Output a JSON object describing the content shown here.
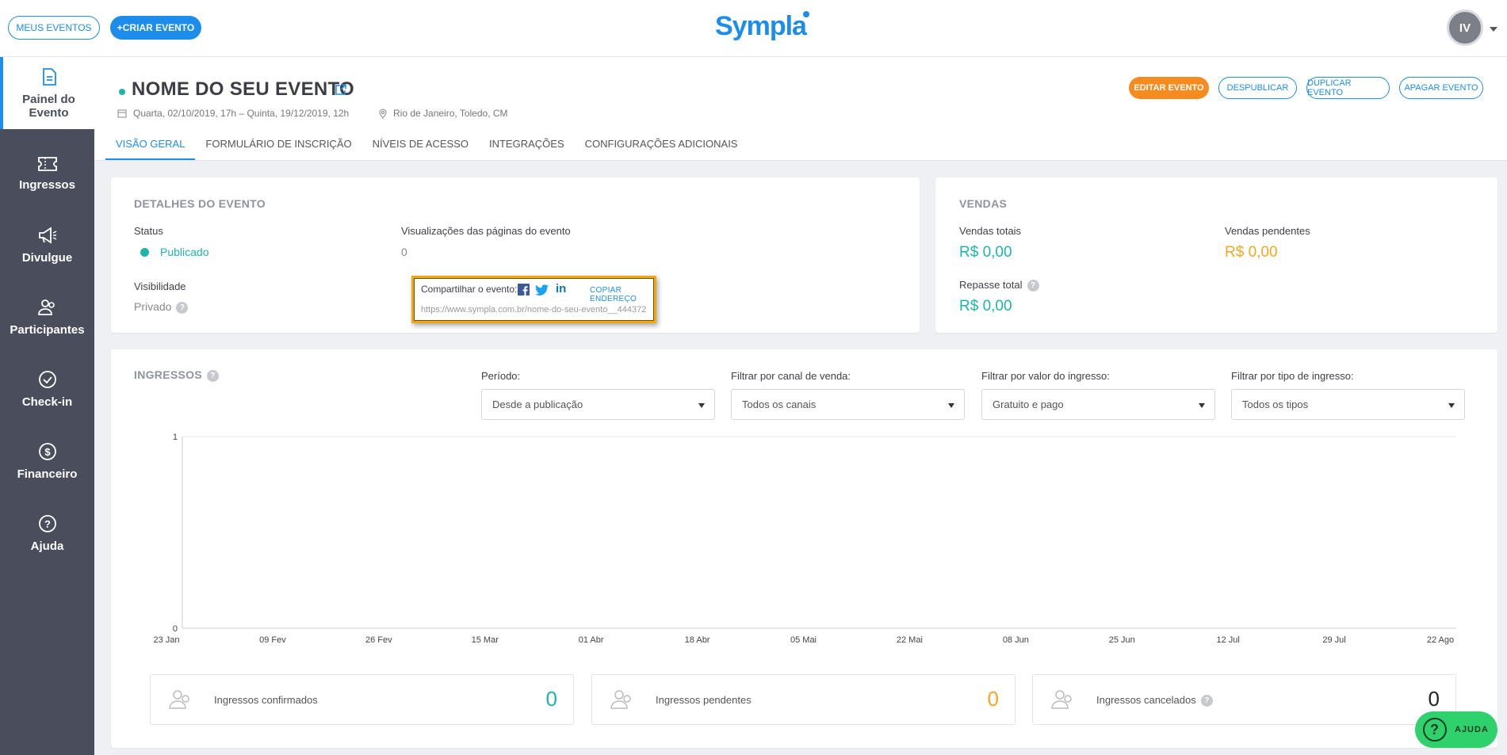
{
  "topbar": {
    "my_events": "MEUS EVENTOS",
    "create_event": "+CRIAR EVENTO",
    "logo": "Sympla",
    "avatar_initials": "IV"
  },
  "sidebar": {
    "items": [
      {
        "label": "Painel do Evento",
        "icon": "document-icon",
        "active": true
      },
      {
        "label": "Ingressos",
        "icon": "ticket-icon"
      },
      {
        "label": "Divulgue",
        "icon": "megaphone-icon"
      },
      {
        "label": "Participantes",
        "icon": "people-icon"
      },
      {
        "label": "Check-in",
        "icon": "check-circle-icon"
      },
      {
        "label": "Financeiro",
        "icon": "dollar-icon"
      },
      {
        "label": "Ajuda",
        "icon": "help-icon"
      }
    ]
  },
  "event": {
    "title": "NOME DO SEU EVENTO",
    "dates": "Quarta, 02/10/2019, 17h – Quinta, 19/12/2019, 12h",
    "location": "Rio de Janeiro, Toledo, CM"
  },
  "header_buttons": {
    "edit": "EDITAR EVENTO",
    "unpublish": "DESPUBLICAR",
    "duplicate": "DUPLICAR EVENTO",
    "delete": "APAGAR EVENTO"
  },
  "tabs": [
    "VISÃO GERAL",
    "FORMULÁRIO DE INSCRIÇÃO",
    "NÍVEIS DE ACESSO",
    "INTEGRAÇÕES",
    "CONFIGURAÇÕES ADICIONAIS"
  ],
  "details": {
    "title": "DETALHES DO EVENTO",
    "status_label": "Status",
    "status_value": "Publicado",
    "views_label": "Visualizações das páginas do evento",
    "views_value": "0",
    "visibility_label": "Visibilidade",
    "visibility_value": "Privado",
    "share_label": "Compartilhar o evento:",
    "copy_link": "COPIAR ENDEREÇO",
    "share_url": "https://www.sympla.com.br/nome-do-seu-evento__444372"
  },
  "sales": {
    "title": "VENDAS",
    "total_label": "Vendas totais",
    "total_value": "R$ 0,00",
    "pending_label": "Vendas pendentes",
    "pending_value": "R$ 0,00",
    "payout_label": "Repasse total",
    "payout_value": "R$ 0,00"
  },
  "tickets": {
    "title": "INGRESSOS",
    "filters": [
      {
        "label": "Período:",
        "value": "Desde a publicação"
      },
      {
        "label": "Filtrar por canal de venda:",
        "value": "Todos os canais"
      },
      {
        "label": "Filtrar por valor do ingresso:",
        "value": "Gratuito e pago"
      },
      {
        "label": "Filtrar por tipo de ingresso:",
        "value": "Todos os tipos"
      }
    ],
    "stats": [
      {
        "label": "Ingressos confirmados",
        "value": "0",
        "color": "#1cb5a8"
      },
      {
        "label": "Ingressos pendentes",
        "value": "0",
        "color": "#f5a623"
      },
      {
        "label": "Ingressos cancelados",
        "value": "0",
        "color": "#222222"
      }
    ]
  },
  "chart_data": {
    "type": "line",
    "x_ticks": [
      "23 Jan",
      "09 Fev",
      "26 Fev",
      "15 Mar",
      "01 Abr",
      "18 Abr",
      "05 Mai",
      "22 Mai",
      "08 Jun",
      "25 Jun",
      "12 Jul",
      "29 Jul",
      "22 Ago"
    ],
    "y_ticks": [
      "0",
      "1"
    ],
    "ylim": [
      0,
      1
    ],
    "series": []
  },
  "help_button": "AJUDA",
  "colors": {
    "accent": "#1c8dea",
    "success": "#1cb5a8",
    "warning": "#f5a623",
    "edit_button": "#f68b1f",
    "sidebar": "#4a4e5c",
    "highlight": "#f2a814"
  }
}
